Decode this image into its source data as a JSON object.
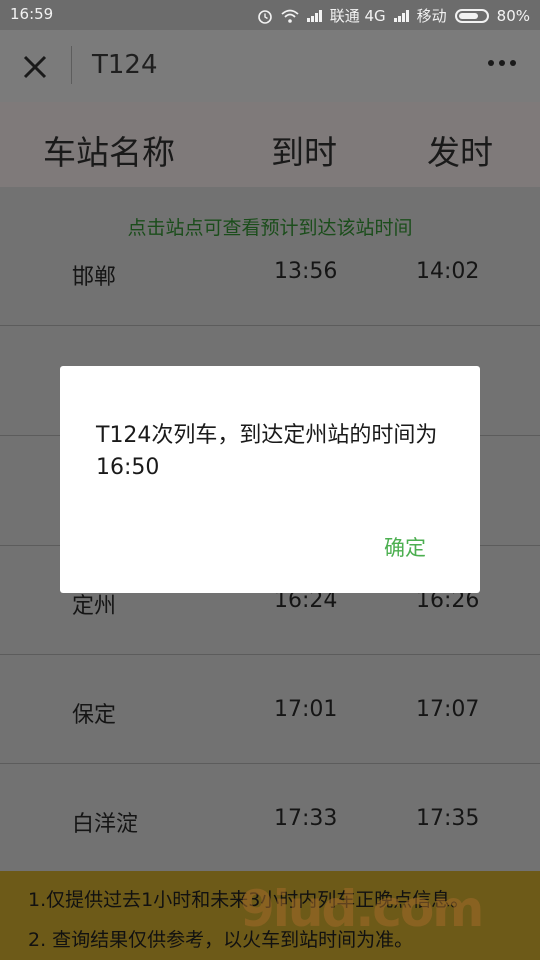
{
  "status_bar": {
    "time": "16:59",
    "carrier1": "联通 4G",
    "carrier2": "移动",
    "battery": "80%",
    "battery_level": 0.8
  },
  "header": {
    "title": "T124",
    "close_icon": "close-icon",
    "more_icon": "more-icon"
  },
  "columns": {
    "station": "车站名称",
    "arrive": "到时",
    "depart": "发时"
  },
  "hint": "点击站点可查看预计到达该站时间",
  "rows": [
    {
      "name": "邯郸",
      "arrive": "13:56",
      "depart": "14:02"
    },
    {
      "name": "",
      "arrive": "",
      "depart": ""
    },
    {
      "name": "",
      "arrive": "",
      "depart": ""
    },
    {
      "name": "定州",
      "arrive": "16:24",
      "depart": "16:26"
    },
    {
      "name": "保定",
      "arrive": "17:01",
      "depart": "17:07"
    },
    {
      "name": "白洋淀",
      "arrive": "17:33",
      "depart": "17:35"
    }
  ],
  "notice": {
    "line1": "1.仅提供过去1小时和未来3小时内列车正晚点信息。",
    "line2": "2. 查询结果仅供参考，以火车到站时间为准。"
  },
  "dialog": {
    "message": "T124次列车，到达定州站的时间为16:50",
    "confirm": "确定"
  },
  "watermark": "9iud.com"
}
